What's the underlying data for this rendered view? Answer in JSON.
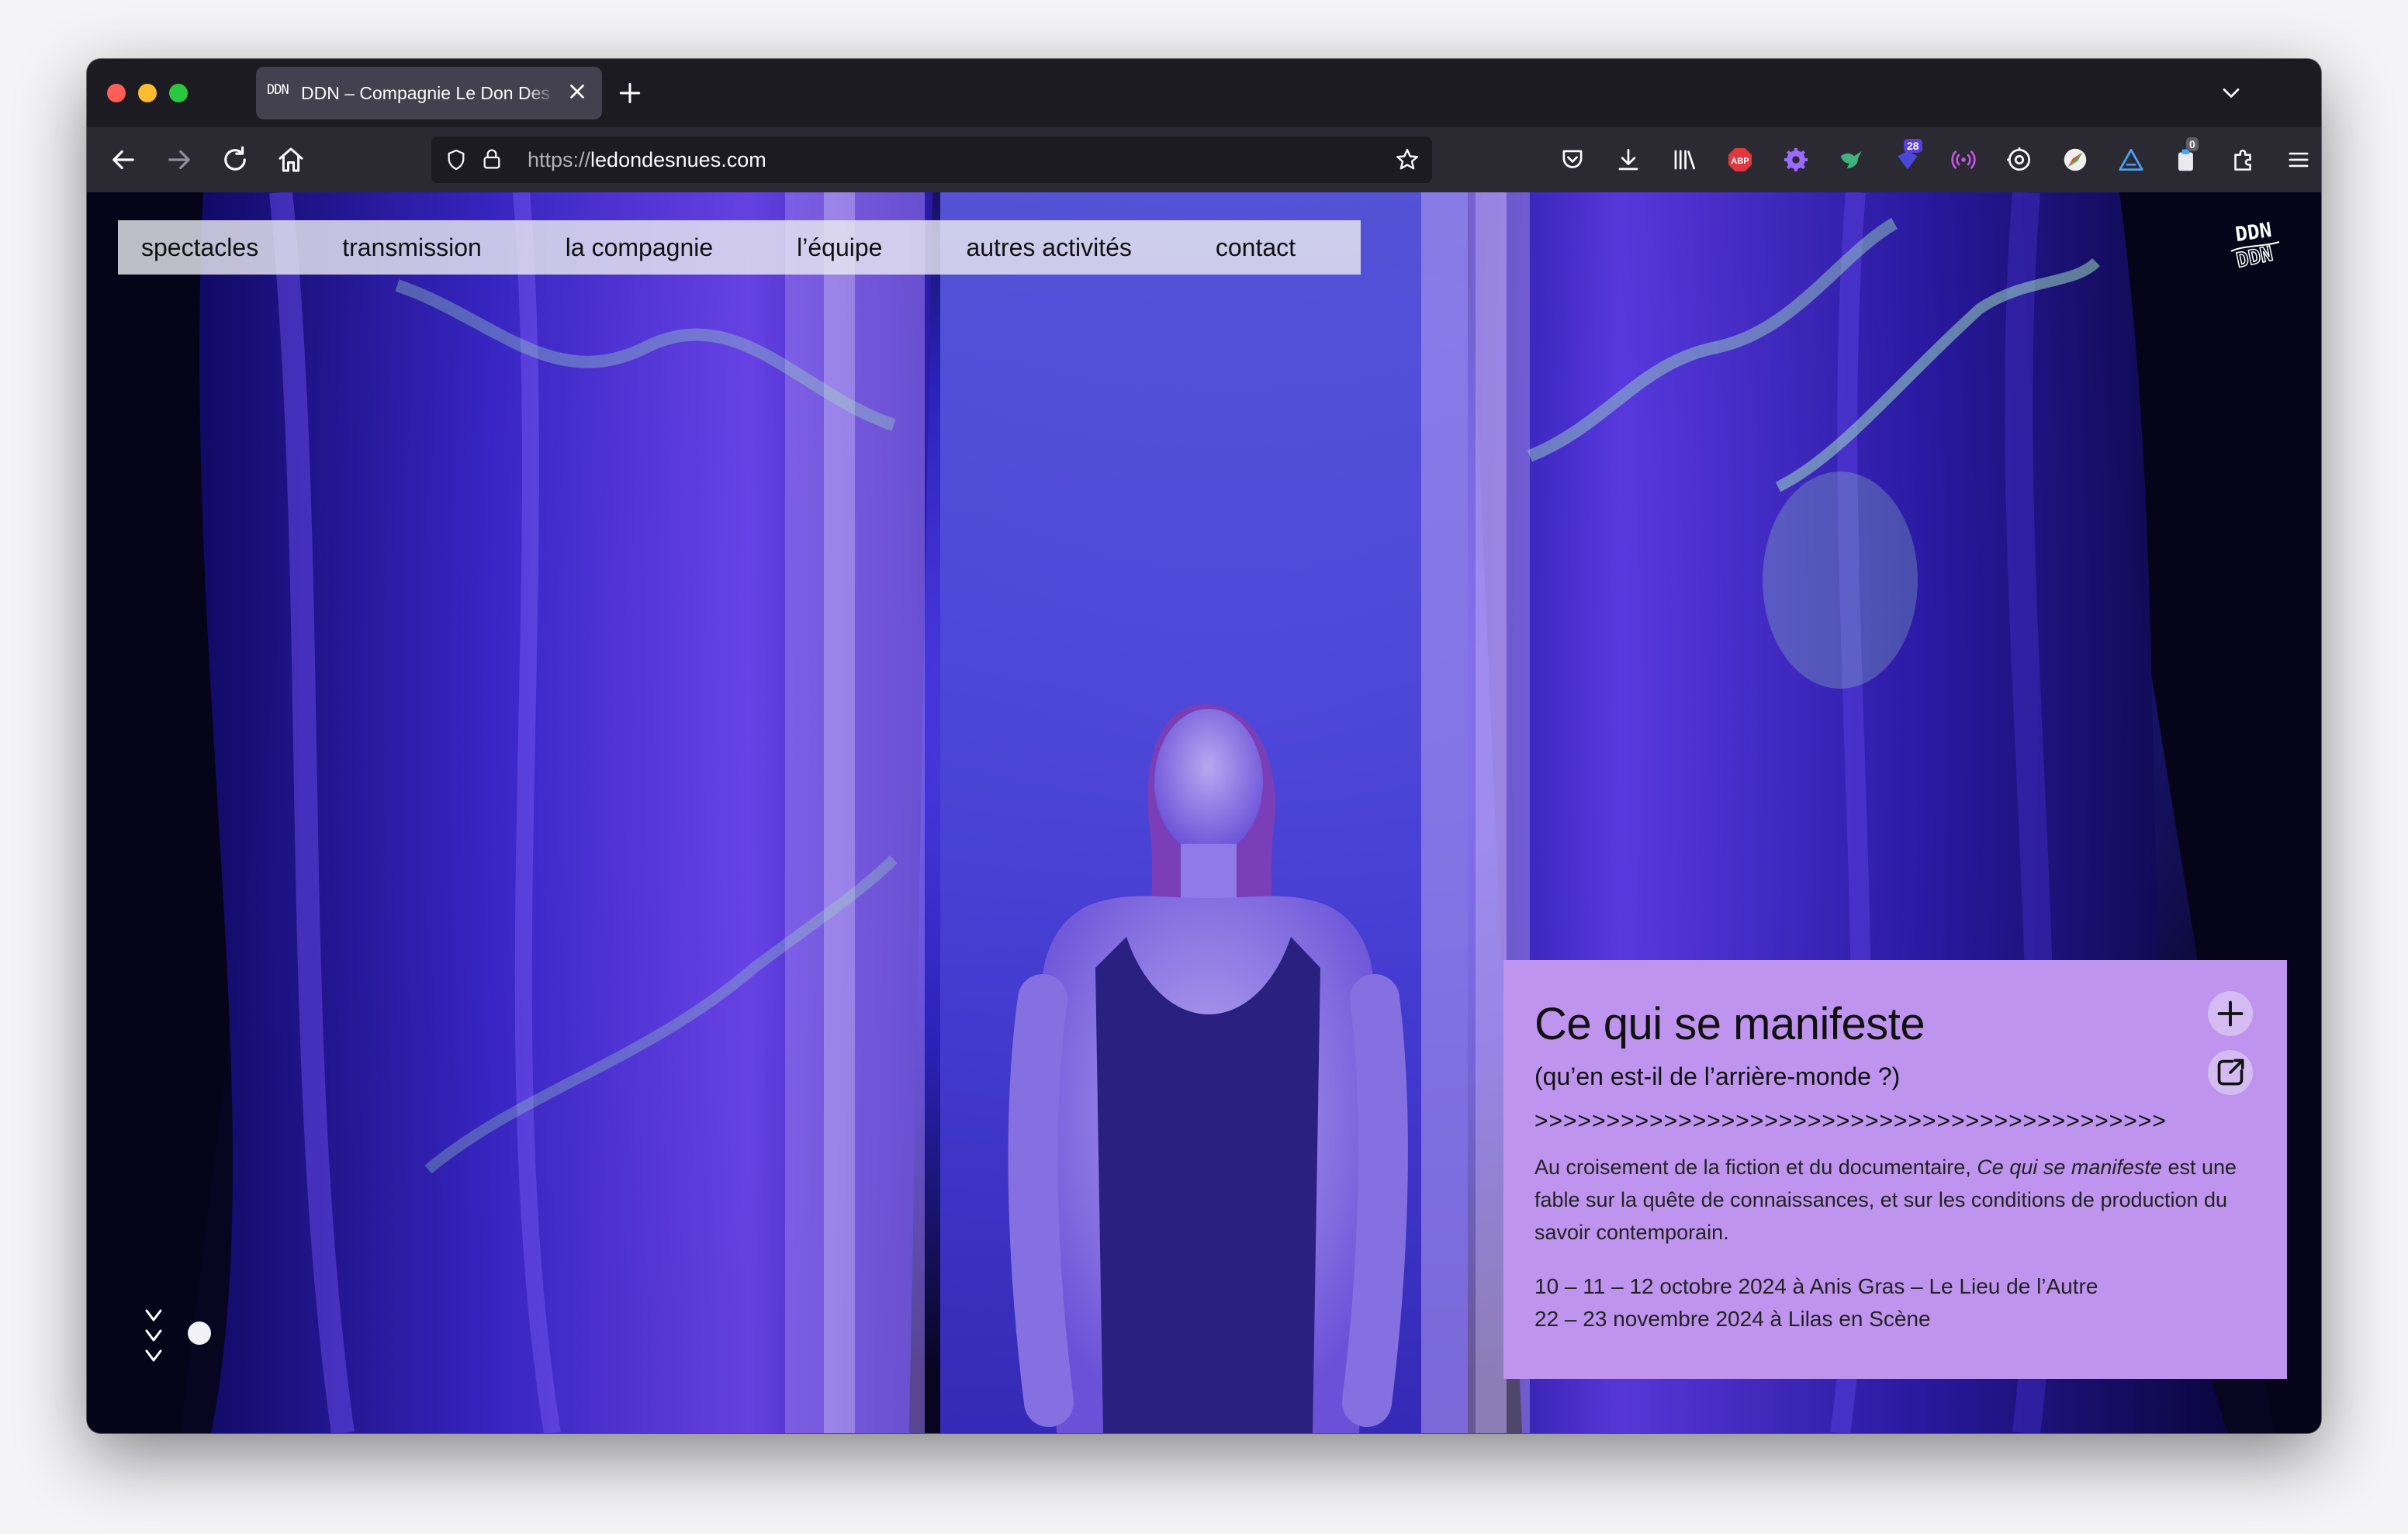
{
  "browser": {
    "tab": {
      "favicon_text": "DDN",
      "title": "DDN – Compagnie Le Don Des Nues"
    },
    "url": {
      "prefix": "https://",
      "domain": "ledondesnues.com"
    },
    "extensions": [
      {
        "name": "abp-icon",
        "label": "ABP"
      },
      {
        "name": "notifications-icon",
        "badge": "28"
      },
      {
        "name": "clipboard-icon",
        "badge": "0"
      }
    ]
  },
  "site": {
    "nav": [
      "spectacles",
      "transmission",
      "la compagnie",
      "l’équipe",
      "autres activités",
      "contact"
    ],
    "logo_text": "DDN",
    "feature": {
      "title": "Ce qui se manifeste",
      "subtitle": "(qu’en est-il de l’arrière-monde ?)",
      "arrows": ">>>>>>>>>>>>>>>>>>>>>>>>>>>>>>>>>>>>>>>>>>>>",
      "description_before": "Au croisement de la fiction et du documentaire, ",
      "description_em": "Ce qui se manifeste",
      "description_after": " est une fable sur la quête de connaissances, et sur les conditions de production du savoir contemporain.",
      "dates": [
        "10 – 11 – 12 octobre 2024 à Anis Gras – Le Lieu de l’Autre",
        "22 – 23 novembre 2024 à Lilas en Scène"
      ]
    }
  },
  "colors": {
    "tab_bar": "#1c1b22",
    "nav_bar": "#2b2a33",
    "card": "#be94ee",
    "accent_purple": "#6a3cff"
  }
}
